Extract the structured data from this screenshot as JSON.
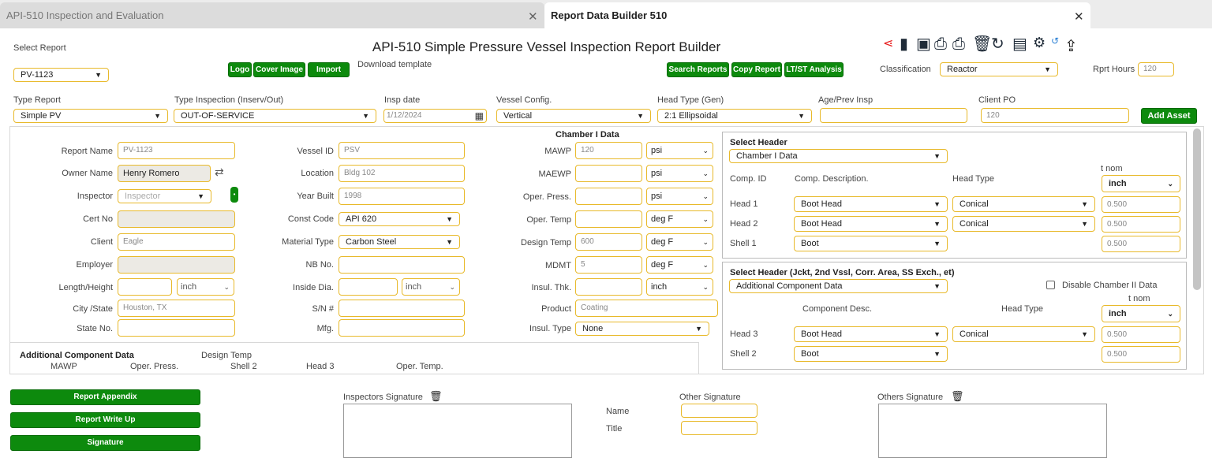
{
  "tabs": [
    {
      "label": "API-510 Inspection and Evaluation"
    },
    {
      "label": "Report Data Builder 510"
    }
  ],
  "header": {
    "select_report_label": "Select Report",
    "select_report_value": "PV-1123",
    "title": "API-510 Simple Pressure Vessel Inspection Report Builder",
    "buttons": {
      "logo": "Logo",
      "cover_image": "Cover Image",
      "import": "Import",
      "search_reports": "Search Reports",
      "copy_report": "Copy Report",
      "ltst": "LT/ST Analysis",
      "add_asset": "Add Asset"
    },
    "download_template": "Download template",
    "classification_label": "Classification",
    "classification_value": "Reactor",
    "rprt_hours_label": "Rprt Hours",
    "rprt_hours_value": "120",
    "icons": [
      "share-icon",
      "new-file-icon",
      "save-icon",
      "print-icon",
      "print-form-icon",
      "trash-icon",
      "refresh-icon",
      "book-icon",
      "gear-icon",
      "history-icon",
      "upload-icon"
    ],
    "accent_color": "#0d8a0d",
    "field_border_color": "#e8b92a"
  },
  "row1": {
    "type_report": {
      "label": "Type Report",
      "value": "Simple PV"
    },
    "type_inspection": {
      "label": "Type Inspection (Inserv/Out)",
      "value": "OUT-OF-SERVICE"
    },
    "insp_date": {
      "label": "Insp date",
      "value": "1/12/2024"
    },
    "vessel_config": {
      "label": "Vessel Config.",
      "value": "Vertical"
    },
    "head_type": {
      "label": "Head Type (Gen)",
      "value": "2:1 Ellipsoidal"
    },
    "age_prev": {
      "label": "Age/Prev Insp",
      "value": ""
    },
    "client_po": {
      "label": "Client PO",
      "value": "120"
    }
  },
  "col1": {
    "report_name": {
      "label": "Report Name",
      "value": "PV-1123"
    },
    "owner_name": {
      "label": "Owner Name",
      "value": "Henry Romero"
    },
    "inspector": {
      "label": "Inspector",
      "value": "Inspector"
    },
    "cert_no": {
      "label": "Cert No",
      "value": ""
    },
    "client": {
      "label": "Client",
      "value": "Eagle"
    },
    "employer": {
      "label": "Employer",
      "value": ""
    },
    "length": {
      "label": "Length/Height",
      "value": "",
      "unit": "inch"
    },
    "city": {
      "label": "City /State",
      "value": "Houston, TX"
    },
    "state_no": {
      "label": "State No.",
      "value": ""
    }
  },
  "col2": {
    "vessel_id": {
      "label": "Vessel ID",
      "value": "PSV"
    },
    "location": {
      "label": "Location",
      "value": "Bldg 102"
    },
    "year_built": {
      "label": "Year Built",
      "value": "1998"
    },
    "const_code": {
      "label": "Const Code",
      "value": "API 620"
    },
    "material": {
      "label": "Material Type",
      "value": "Carbon Steel"
    },
    "nb_no": {
      "label": "NB No.",
      "value": ""
    },
    "inside_dia": {
      "label": "Inside Dia.",
      "value": "",
      "unit": "inch"
    },
    "sn": {
      "label": "S/N #",
      "value": ""
    },
    "mfg": {
      "label": "Mfg.",
      "value": ""
    }
  },
  "col3": {
    "heading": "Chamber I Data",
    "mawp": {
      "label": "MAWP",
      "value": "120",
      "unit": "psi"
    },
    "maewp": {
      "label": "MAEWP",
      "value": "",
      "unit": "psi"
    },
    "oper_press": {
      "label": "Oper. Press.",
      "value": "",
      "unit": "psi"
    },
    "oper_temp": {
      "label": "Oper. Temp",
      "value": "",
      "unit": "deg F"
    },
    "design_temp": {
      "label": "Design Temp",
      "value": "600",
      "unit": "deg F"
    },
    "mdmt": {
      "label": "MDMT",
      "value": "5",
      "unit": "deg F"
    },
    "insul_thk": {
      "label": "Insul. Thk.",
      "value": "",
      "unit": "inch"
    },
    "product": {
      "label": "Product",
      "value": "Coating"
    },
    "insul_type": {
      "label": "Insul. Type",
      "value": "None"
    }
  },
  "additional": {
    "title": "Additional Component Data",
    "design_temp": "Design Temp",
    "cols": [
      "MAWP",
      "Oper. Press.",
      "Shell 2",
      "Head 3",
      "Oper. Temp."
    ]
  },
  "panel1": {
    "title": "Select Header",
    "select": "Chamber I Data",
    "tnom_label": "t nom",
    "tnom_unit": "inch",
    "col_id": "Comp. ID",
    "col_desc": "Comp. Description.",
    "col_head": "Head Type",
    "rows": [
      {
        "id": "Head 1",
        "desc": "Boot Head",
        "head": "Conical",
        "t": "0.500"
      },
      {
        "id": "Head 2",
        "desc": "Boot Head",
        "head": "Conical",
        "t": "0.500"
      },
      {
        "id": "Shell 1",
        "desc": "Boot",
        "t": "0.500"
      }
    ]
  },
  "panel2": {
    "title": "Select Header (Jckt, 2nd Vssl, Corr. Area, SS Exch., et)",
    "select": "Additional Component  Data",
    "disable_label": "Disable Chamber II Data",
    "disable_checked": false,
    "tnom_label": "t nom",
    "tnom_unit": "inch",
    "col_desc": "Component Desc.",
    "col_head": "Head Type",
    "rows": [
      {
        "id": "Head 3",
        "desc": "Boot Head",
        "head": "Conical",
        "t": "0.500"
      },
      {
        "id": "Shell 2",
        "desc": "Boot",
        "t": "0.500"
      }
    ]
  },
  "footer": {
    "buttons": [
      "Report Appendix",
      "Report Write Up",
      "Signature"
    ],
    "inspectors_signature": "Inspectors Signature",
    "other_signature": "Other Signature",
    "others_signature": "Others Signature",
    "name_label": "Name",
    "title_label": "Title"
  }
}
